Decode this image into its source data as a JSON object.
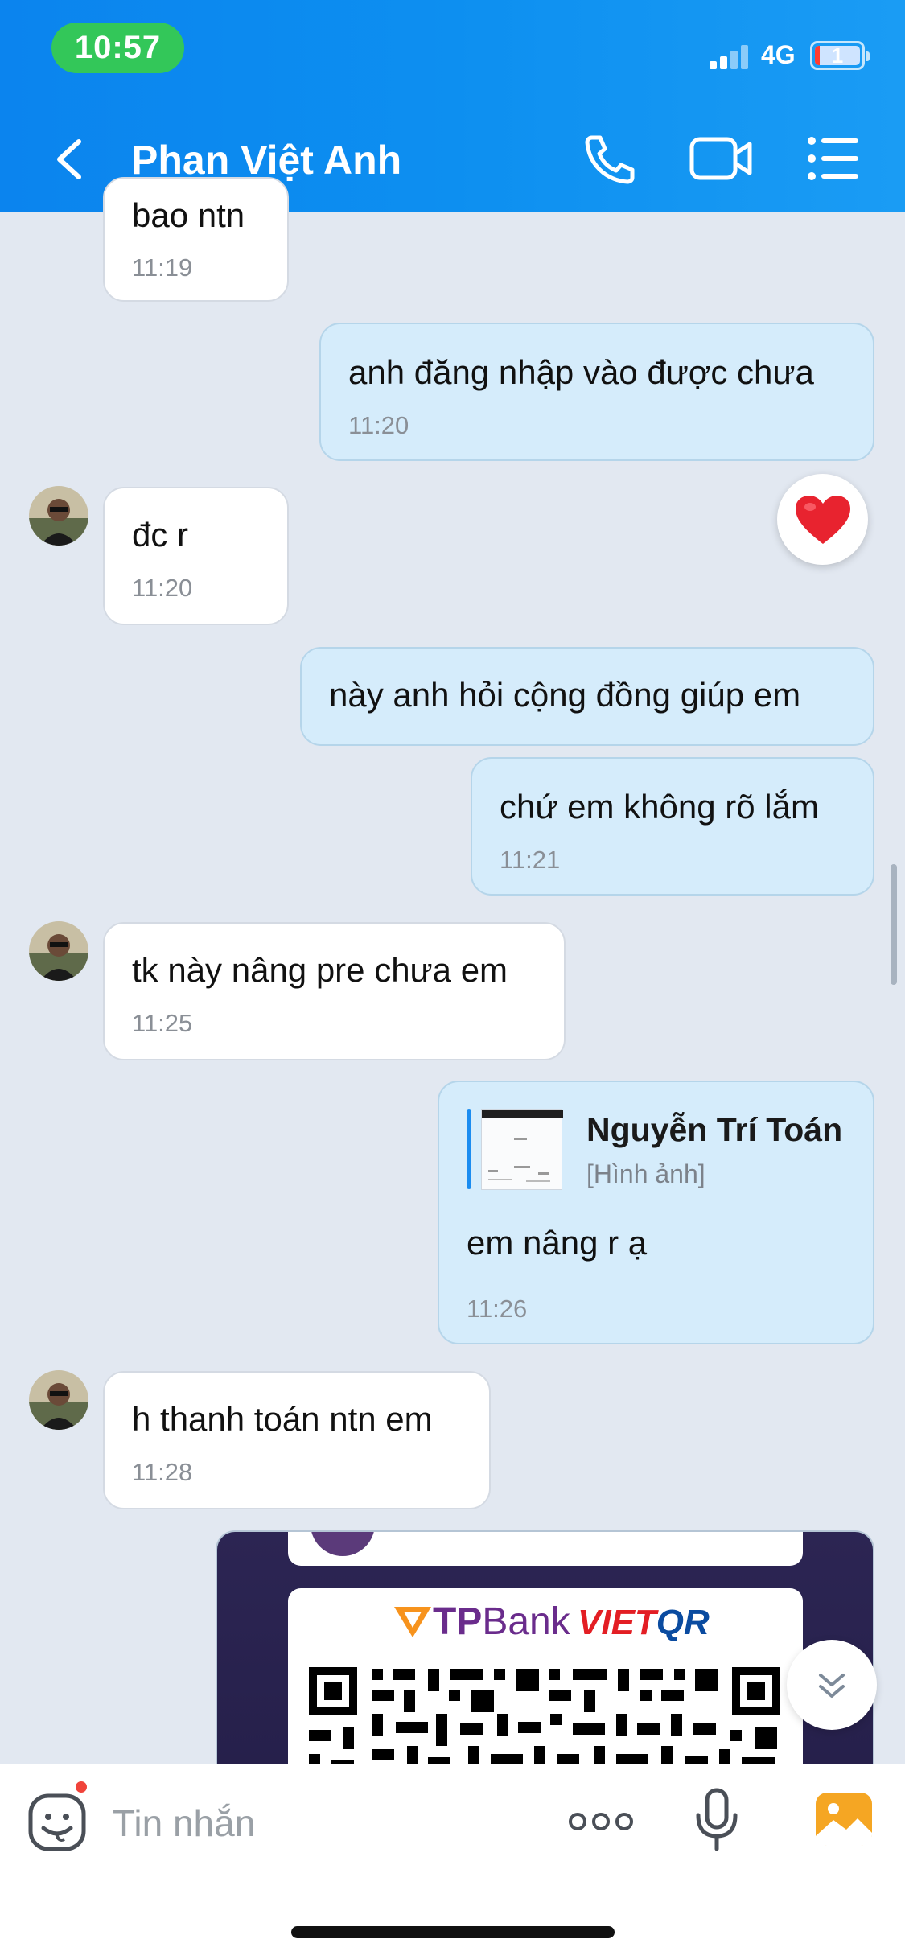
{
  "status_bar": {
    "time": "10:57",
    "network": "4G",
    "battery_label": "1"
  },
  "header": {
    "title": "Phan Việt Anh",
    "icons": [
      "back-icon",
      "phone-icon",
      "video-call-icon",
      "menu-list-icon"
    ]
  },
  "messages": [
    {
      "side": "in",
      "text": "bao ntn",
      "time": "11:19"
    },
    {
      "side": "out",
      "text": "anh đăng nhập vào được chưa",
      "time": "11:20"
    },
    {
      "side": "in",
      "text": "đc r",
      "time": "11:20",
      "reaction": "heart"
    },
    {
      "side": "out",
      "text": "này anh hỏi cộng đồng giúp em"
    },
    {
      "side": "out",
      "text": "chứ em không rõ lắm",
      "time": "11:21"
    },
    {
      "side": "in",
      "text": "tk này nâng pre chưa em",
      "time": "11:25"
    },
    {
      "side": "out",
      "quote": {
        "name": "Nguyễn Trí Toán",
        "type": "[Hình ảnh]"
      },
      "text": "em nâng r ạ",
      "time": "11:26"
    },
    {
      "side": "in",
      "text": "h thanh toán ntn em",
      "time": "11:28"
    },
    {
      "side": "out",
      "image": {
        "logo_bank_1": "TP",
        "logo_bank_2": "Bank",
        "logo_qr_1": "VIET",
        "logo_qr_2": "QR"
      }
    }
  ],
  "composer": {
    "placeholder": "Tin nhắn"
  },
  "colors": {
    "header": "#0d8ff0",
    "outgoing_bubble": "#d5ecfb",
    "incoming_bubble": "#ffffff",
    "background": "#e2e8f1",
    "status_time_pill": "#33c759"
  }
}
